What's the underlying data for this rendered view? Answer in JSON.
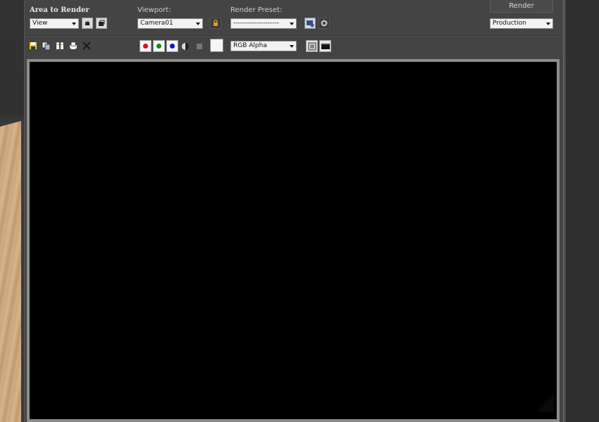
{
  "area_to_render": {
    "label": "Area to Render",
    "value": "View"
  },
  "viewport": {
    "label": "Viewport:",
    "value": "Camera01"
  },
  "render_preset": {
    "label": "Render Preset:",
    "value": "--------------------"
  },
  "render": {
    "button_label": "Render",
    "mode_value": "Production"
  },
  "channels": {
    "red_color": "#e01010",
    "green_color": "#0c8c1c",
    "blue_color": "#1010d0",
    "display_value": "RGB Alpha"
  },
  "colors": {
    "window": "#444444",
    "canvas": "#000000",
    "canvas_frame": "#8c8c8c"
  },
  "icons": [
    "crop-region-icon",
    "auto-region-icon",
    "lock-icon",
    "render-setup-icon",
    "environment-icon",
    "save-image-icon",
    "copy-image-icon",
    "clone-frame-buffer-icon",
    "print-icon",
    "clear-icon",
    "red-channel-icon",
    "green-channel-icon",
    "blue-channel-icon",
    "mono-channel-icon",
    "alpha-channel-icon",
    "swatch-icon",
    "toggle-ui-overlay-icon",
    "toggle-ui-icon"
  ]
}
